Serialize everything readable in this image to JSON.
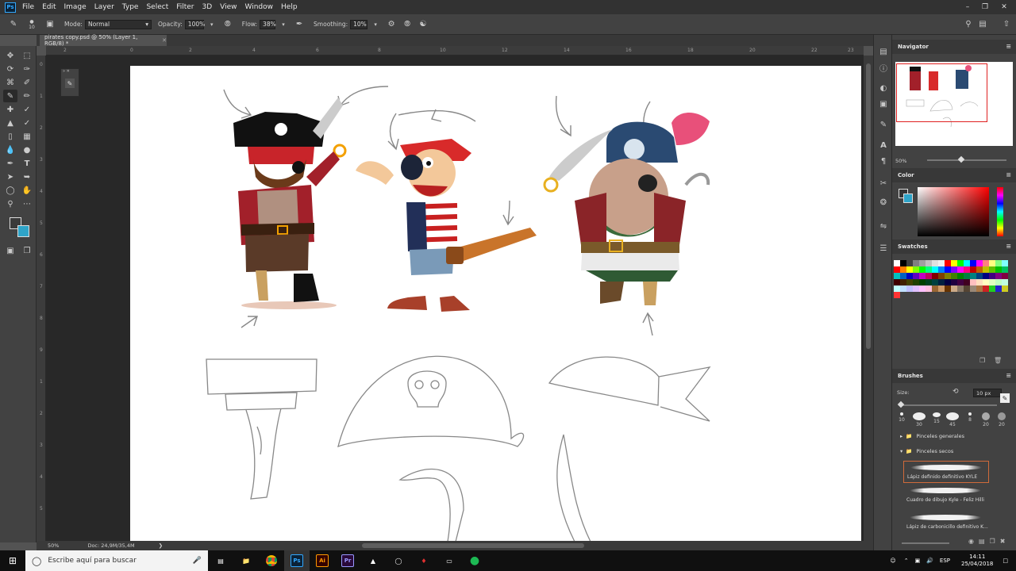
{
  "menubar": {
    "logo": "Ps",
    "items": [
      "File",
      "Edit",
      "Image",
      "Layer",
      "Type",
      "Select",
      "Filter",
      "3D",
      "View",
      "Window",
      "Help"
    ]
  },
  "options": {
    "brush_size": "10",
    "mode_label": "Mode:",
    "mode_value": "Normal",
    "opacity_label": "Opacity:",
    "opacity_value": "100%",
    "flow_label": "Flow:",
    "flow_value": "38%",
    "smoothing_label": "Smoothing:",
    "smoothing_value": "10%"
  },
  "document": {
    "tab_title": "pirates copy.psd @ 50% (Layer 1, RGB/8) *",
    "zoom": "50%",
    "doc_info": "Doc: 24,9M/35,4M"
  },
  "rulers": {
    "h_ticks": [
      "2",
      "0",
      "2",
      "4",
      "6",
      "8",
      "10",
      "12",
      "14",
      "16",
      "18",
      "20",
      "22",
      "23"
    ],
    "v_ticks": [
      "0",
      "1",
      "2",
      "3",
      "4",
      "5",
      "6",
      "7",
      "8",
      "9",
      "1",
      "2",
      "3",
      "4",
      "5"
    ]
  },
  "navigator": {
    "title": "Navigator",
    "zoom": "50%"
  },
  "color_panel": {
    "title": "Color"
  },
  "swatches": {
    "title": "Swatches",
    "colors": [
      "#ffffff",
      "#000000",
      "#404040",
      "#808080",
      "#a0a0a0",
      "#c0c0c0",
      "#e0e0e0",
      "#f0f0f0",
      "#ff0000",
      "#ffff00",
      "#00ff00",
      "#00ffff",
      "#0000ff",
      "#ff00ff",
      "#ff8080",
      "#ffff80",
      "#80ff80",
      "#80ffff",
      "#ff0000",
      "#ff8000",
      "#ffff00",
      "#80ff00",
      "#00ff00",
      "#00ff80",
      "#00ffff",
      "#0080ff",
      "#0000ff",
      "#8000ff",
      "#ff00ff",
      "#ff0080",
      "#c00000",
      "#c06000",
      "#c0c000",
      "#60c000",
      "#00c000",
      "#00c060",
      "#00c0c0",
      "#0060c0",
      "#0000c0",
      "#6000c0",
      "#c000c0",
      "#c00060",
      "#800000",
      "#804000",
      "#808000",
      "#408000",
      "#008000",
      "#008040",
      "#008080",
      "#004080",
      "#000080",
      "#400080",
      "#800080",
      "#800040",
      "#400000",
      "#402000",
      "#404000",
      "#204000",
      "#004000",
      "#004020",
      "#004040",
      "#002040",
      "#000040",
      "#200040",
      "#400040",
      "#400020",
      "#ffc0c0",
      "#ffe0c0",
      "#ffffc0",
      "#e0ffc0",
      "#c0ffc0",
      "#c0ffe0",
      "#c0ffff",
      "#c0e0ff",
      "#c0c0ff",
      "#e0c0ff",
      "#ffc0ff",
      "#ffc0e0",
      "#996633",
      "#cc9966",
      "#663300",
      "#ccaa88",
      "#887766",
      "#554433",
      "#998877",
      "#aa7744",
      "#cc2222",
      "#22cc22",
      "#2222cc",
      "#cccc22",
      "#ff3333"
    ]
  },
  "brushes": {
    "title": "Brushes",
    "size_label": "Size:",
    "size_value": "10 px",
    "tip_sizes": [
      "10",
      "30",
      "15",
      "45",
      "8",
      "20",
      "20"
    ],
    "folders": [
      "Pinceles generales",
      "Pinceles secos"
    ],
    "presets": [
      "Lápiz definido definitivo KYLE",
      "Cuadro de dibujo Kyle - Feliz Hilli",
      "Lápiz de carbonicillo definitivo K..."
    ]
  },
  "taskbar": {
    "search_placeholder": "Escribe aquí para buscar",
    "apps": [
      "Ps",
      "Ai",
      "Pr"
    ],
    "lang": "ESP",
    "time": "14:11",
    "date": "25/04/2018"
  },
  "colors": {
    "app_bg": "#535353",
    "panel_bg": "#424242",
    "selection_red": "#e02020",
    "ps_blue": "#31a8ff",
    "ai_orange": "#ff9a00",
    "pr_purple": "#9999ff"
  }
}
